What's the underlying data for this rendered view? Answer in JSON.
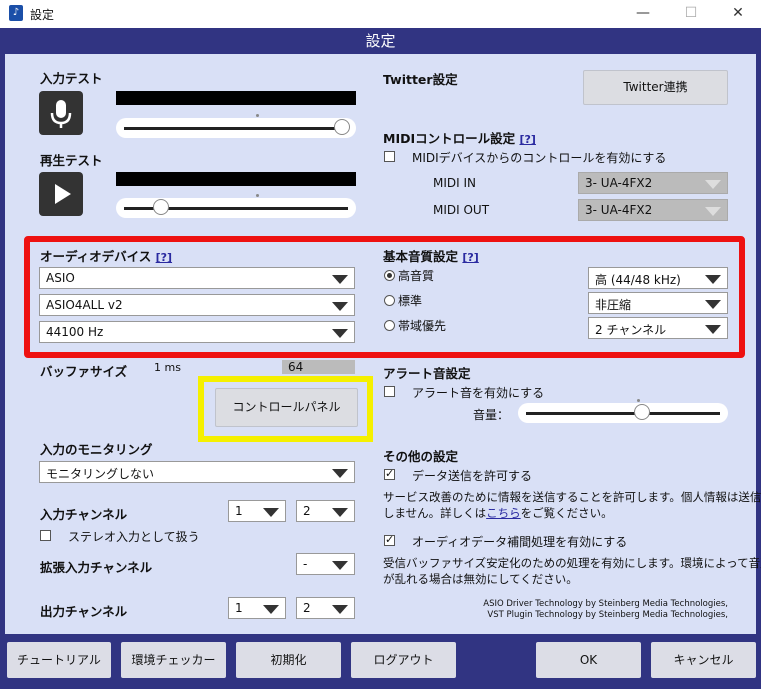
{
  "window": {
    "title": "設定",
    "minimize": "—",
    "maximize": "☐",
    "close": "✕",
    "icon": "app-icon"
  },
  "header": {
    "title": "設定"
  },
  "input_test": {
    "label": "入力テスト",
    "icon": "microphone-icon",
    "level": 0.98
  },
  "playback_test": {
    "label": "再生テスト",
    "icon": "play-icon",
    "level": 0.16
  },
  "twitter": {
    "label": "Twitter設定",
    "button": "Twitter連携"
  },
  "midi": {
    "label": "MIDIコントロール設定",
    "help": "[?]",
    "enable_label": "MIDIデバイスからのコントロールを有効にする",
    "in_label": "MIDI IN",
    "in_value": "3- UA-4FX2",
    "out_label": "MIDI OUT",
    "out_value": "3- UA-4FX2"
  },
  "audio_device": {
    "label": "オーディオデバイス",
    "help": "[?]",
    "driver": "ASIO",
    "device": "ASIO4ALL v2",
    "rate": "44100 Hz"
  },
  "quality": {
    "label": "基本音質設定",
    "help": "[?]",
    "options": [
      "高音質",
      "標準",
      "帯域優先"
    ],
    "selected": 0,
    "values": [
      "高 (44/48 kHz)",
      "非圧縮",
      "2 チャンネル"
    ]
  },
  "buffer": {
    "label": "バッファサイズ",
    "ms": "1 ms",
    "value": "64"
  },
  "control_panel": {
    "button": "コントロールパネル"
  },
  "alert": {
    "label": "アラート音設定",
    "enable_label": "アラート音を有効にする",
    "volume_label": "音量：",
    "volume": 0.6
  },
  "monitoring": {
    "label": "入力のモニタリング",
    "value": "モニタリングしない"
  },
  "input_channel": {
    "label": "入力チャンネル",
    "ch1": "1",
    "ch2": "2",
    "stereo_label": "ステレオ入力として扱う"
  },
  "ext_input_channel": {
    "label": "拡張入力チャンネル",
    "value": "-"
  },
  "output_channel": {
    "label": "出力チャンネル",
    "ch1": "1",
    "ch2": "2"
  },
  "other": {
    "label": "その他の設定",
    "data_send_label": "データ送信を許可する",
    "data_send_desc_1": "サービス改善のために情報を送信することを許可します。個人情報は送信",
    "data_send_desc_2a": "しません。詳しくは",
    "data_send_link": "こちら",
    "data_send_desc_2b": "をご覧ください。",
    "audio_fix_label": "オーディオデータ補間処理を有効にする",
    "audio_fix_desc_1": "受信バッファサイズ安定化のための処理を有効にします。環境によって音声",
    "audio_fix_desc_2": "が乱れる場合は無効にしてください。"
  },
  "credits": {
    "line1": "ASIO Driver Technology by Steinberg Media Technologies,",
    "line2": "VST Plugin Technology by Steinberg Media Technologies,"
  },
  "bottom": {
    "tutorial": "チュートリアル",
    "env_checker": "環境チェッカー",
    "reset": "初期化",
    "logout": "ログアウト",
    "ok": "OK",
    "cancel": "キャンセル"
  },
  "colors": {
    "header": "#313482",
    "panel": "#d9e0f6",
    "highlight_red": "#ee1111",
    "highlight_yellow": "#f5f000"
  }
}
